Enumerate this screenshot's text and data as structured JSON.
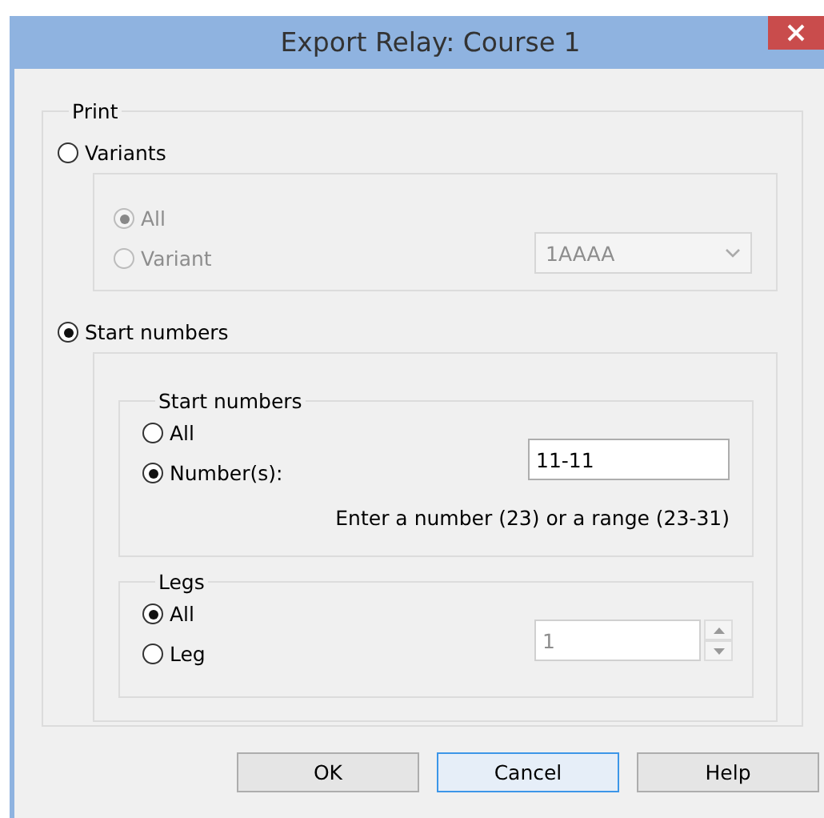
{
  "window": {
    "title": "Export Relay: Course 1"
  },
  "print": {
    "label": "Print",
    "variants": {
      "label": "Variants",
      "selected": false,
      "options": [
        {
          "label": "All",
          "selected": true,
          "disabled": true
        },
        {
          "label": "Variant",
          "selected": false,
          "disabled": true
        }
      ],
      "variant_dropdown": {
        "value": "1AAAA",
        "disabled": true
      }
    },
    "start_numbers": {
      "label": "Start numbers",
      "selected": true,
      "numbers_group": {
        "label": "Start numbers",
        "options": [
          {
            "label": "All",
            "selected": false,
            "disabled": false
          },
          {
            "label": "Number(s):",
            "selected": true,
            "disabled": false
          }
        ],
        "numbers_field": {
          "value": "11-11"
        },
        "hint": "Enter a number (23) or a range (23-31)"
      },
      "legs_group": {
        "label": "Legs",
        "options": [
          {
            "label": "All",
            "selected": true,
            "disabled": false
          },
          {
            "label": "Leg",
            "selected": false,
            "disabled": false
          }
        ],
        "leg_spinner": {
          "value": "1",
          "disabled": true
        }
      }
    }
  },
  "buttons": [
    {
      "label": "OK",
      "focused": false
    },
    {
      "label": "Cancel",
      "focused": true
    },
    {
      "label": "Help",
      "focused": false
    }
  ]
}
